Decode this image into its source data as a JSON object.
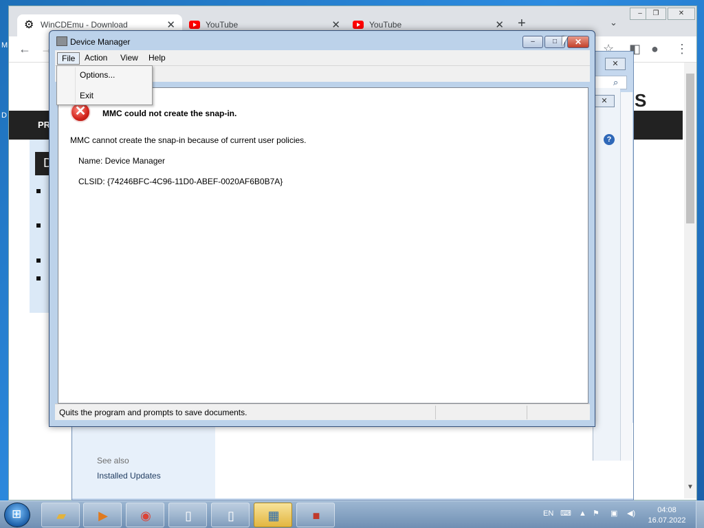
{
  "desktop": {
    "frag_top": "M",
    "frag_mid": "D"
  },
  "chrome": {
    "tabs": [
      {
        "title": "WinCDEmu - Download",
        "icon": "gear-icon"
      },
      {
        "title": "YouTube",
        "icon": "youtube-icon"
      },
      {
        "title": "YouTube",
        "icon": "youtube-icon"
      }
    ],
    "new_tab": "+",
    "tab_list": "⌄",
    "window_ctrls": {
      "minimize": "–",
      "restore": "❐",
      "close": "✕"
    },
    "toolbar": {
      "back": "←",
      "forward": "→",
      "star": "☆",
      "sidepanel": "◧",
      "profile": "●",
      "menu": "⋮"
    },
    "page": {
      "nav_text": "PR",
      "side_heading": "D",
      "logo_fragment": "S"
    }
  },
  "control_panel": {
    "close": "✕",
    "see_also": "See also",
    "installed_updates": "Installed Updates",
    "help": "?"
  },
  "device_manager": {
    "title": "Device Manager",
    "buttons": {
      "minimize": "–",
      "maximize": "□",
      "close": "✕"
    },
    "menu": [
      "File",
      "Action",
      "View",
      "Help"
    ],
    "file_menu": [
      "Options...",
      "Exit"
    ],
    "error": {
      "heading": "MMC could not create the snap-in.",
      "message": "MMC cannot create the snap-in because of current user policies.",
      "name_line": "Name: Device Manager",
      "clsid_line": "CLSID: {74246BFC-4C96-11D0-ABEF-0020AF6B0B7A}"
    },
    "status": "Quits the program and prompts to save documents."
  },
  "taskbar": {
    "language": "EN",
    "time": "04:08",
    "date": "16.07.2022",
    "apps": [
      "explorer",
      "media-player",
      "chrome",
      "notepad",
      "notepad",
      "control-panel",
      "toolbox"
    ]
  }
}
